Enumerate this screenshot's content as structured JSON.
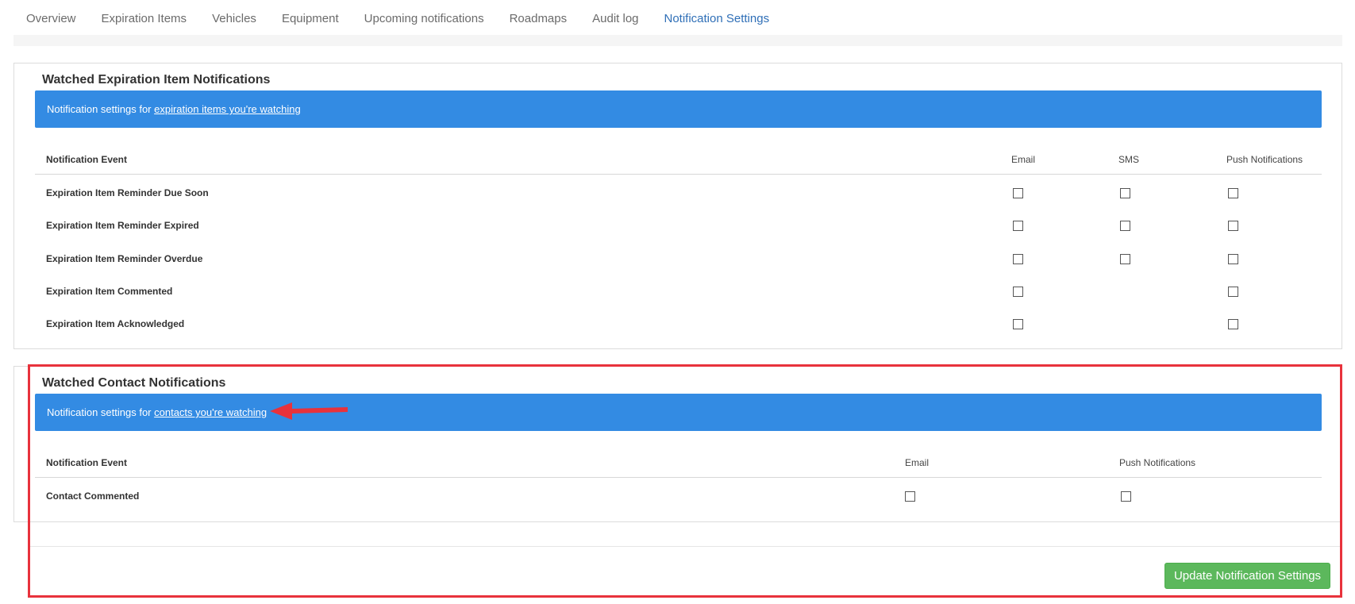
{
  "tabs": [
    {
      "label": "Overview"
    },
    {
      "label": "Expiration Items"
    },
    {
      "label": "Vehicles"
    },
    {
      "label": "Equipment"
    },
    {
      "label": "Upcoming notifications"
    },
    {
      "label": "Roadmaps"
    },
    {
      "label": "Audit log"
    },
    {
      "label": "Notification Settings",
      "active": true
    }
  ],
  "expiration_section": {
    "title": "Watched Expiration Item Notifications",
    "info_prefix": "Notification settings for ",
    "info_link": "expiration items you're watching",
    "columns": {
      "event": "Notification Event",
      "email": "Email",
      "sms": "SMS",
      "push": "Push Notifications"
    },
    "rows": [
      {
        "label": "Expiration Item Reminder Due Soon",
        "email": false,
        "sms": false,
        "push": false
      },
      {
        "label": "Expiration Item Reminder Expired",
        "email": false,
        "sms": false,
        "push": false
      },
      {
        "label": "Expiration Item Reminder Overdue",
        "email": false,
        "sms": false,
        "push": false
      },
      {
        "label": "Expiration Item Commented",
        "email": false,
        "push": false
      },
      {
        "label": "Expiration Item Acknowledged",
        "email": false,
        "push": false
      }
    ]
  },
  "contact_section": {
    "title": "Watched Contact Notifications",
    "info_prefix": "Notification settings for ",
    "info_link": "contacts you're watching",
    "columns": {
      "event": "Notification Event",
      "email": "Email",
      "push": "Push Notifications"
    },
    "rows": [
      {
        "label": "Contact Commented",
        "email": false,
        "push": false
      }
    ]
  },
  "update_button": "Update Notification Settings",
  "colors": {
    "accent": "#2f6fb7",
    "info_bar": "#338be3",
    "button": "#5cb85c",
    "annotation": "#e8323c"
  }
}
